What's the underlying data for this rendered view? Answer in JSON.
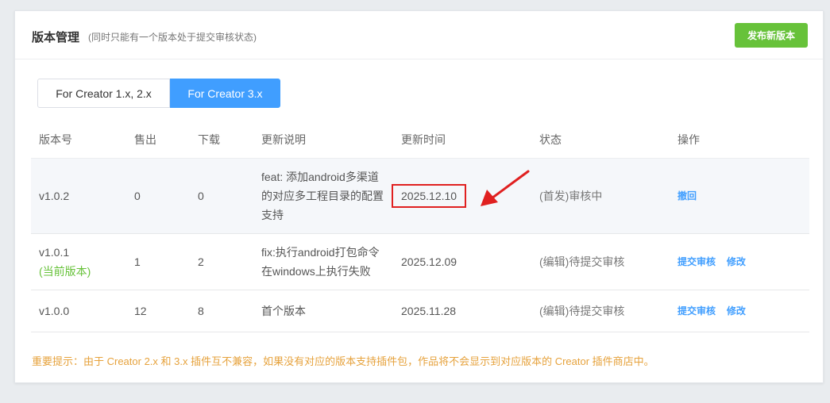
{
  "header": {
    "title": "版本管理",
    "subtitle": "(同时只能有一个版本处于提交审核状态)",
    "publish_label": "发布新版本"
  },
  "tabs": [
    {
      "label": "For Creator 1.x, 2.x",
      "active": false
    },
    {
      "label": "For Creator 3.x",
      "active": true
    }
  ],
  "table": {
    "columns": [
      "版本号",
      "售出",
      "下载",
      "更新说明",
      "更新时间",
      "状态",
      "操作"
    ],
    "rows": [
      {
        "version": "v1.0.2",
        "current_tag": "",
        "sold": "0",
        "downloads": "0",
        "notes": "feat: 添加android多渠道的对应多工程目录的配置支持",
        "notes_lines": [
          "feat: 添加android多渠道",
          "的对应多工程目录的配置",
          "支持"
        ],
        "updated": "2025.12.10",
        "status": "(首发)审核中",
        "actions": [
          "撤回"
        ]
      },
      {
        "version": "v1.0.1",
        "current_tag": "(当前版本)",
        "sold": "1",
        "downloads": "2",
        "notes": "fix:执行android打包命令在windows上执行失败",
        "notes_lines": [
          "fix:执行android打包命令",
          "在windows上执行失败"
        ],
        "updated": "2025.12.09",
        "status": "(编辑)待提交审核",
        "actions": [
          "提交审核",
          "修改"
        ]
      },
      {
        "version": "v1.0.0",
        "current_tag": "",
        "sold": "12",
        "downloads": "8",
        "notes": "首个版本",
        "notes_lines": [
          "首个版本"
        ],
        "updated": "2025.11.28",
        "status": "(编辑)待提交审核",
        "actions": [
          "提交审核",
          "修改"
        ]
      }
    ]
  },
  "notice": "重要提示：由于 Creator 2.x 和 3.x 插件互不兼容，如果没有对应的版本支持插件包，作品将不会显示到对应版本的 Creator 插件商店中。",
  "colors": {
    "accent_blue": "#409eff",
    "success_green": "#67c23a",
    "warning_orange": "#e6a23c",
    "highlight_red": "#e02020"
  }
}
